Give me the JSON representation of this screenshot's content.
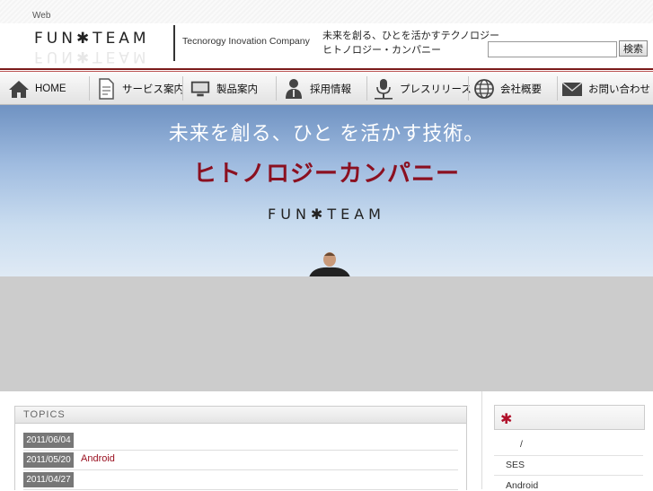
{
  "header": {
    "web_label": "Web",
    "logo_text": "FUN✱TEAM",
    "company": "Tecnorogy Inovation Company",
    "tagline_1": "未来を創る、ひとを活かすテクノロジー",
    "tagline_2": "ヒトノロジー・カンパニー",
    "search_value": "",
    "search_button": "検索"
  },
  "nav": {
    "items": [
      {
        "label": "HOME",
        "icon": "home-icon"
      },
      {
        "label": "サービス案内",
        "icon": "document-icon"
      },
      {
        "label": "製品案内",
        "icon": "monitor-icon"
      },
      {
        "label": "採用情報",
        "icon": "person-icon"
      },
      {
        "label": "プレスリリース",
        "icon": "microphone-icon"
      },
      {
        "label": "会社概要",
        "icon": "globe-icon"
      },
      {
        "label": "お問い合わせ",
        "icon": "mail-icon"
      }
    ]
  },
  "hero": {
    "line1": "未来を創る、ひと を活かす技術。",
    "line2": "ヒトノロジーカンパニー",
    "logo": "FUN✱TEAM"
  },
  "topics": {
    "heading": "TOPICS",
    "rows": [
      {
        "date": "2011/06/04",
        "title": ""
      },
      {
        "date": "2011/05/20",
        "title": "Android"
      },
      {
        "date": "2011/04/27",
        "title": ""
      }
    ]
  },
  "sidebar": {
    "links": [
      "/",
      "SES",
      "Android"
    ]
  },
  "colors": {
    "brand_red": "#8b1020",
    "accent_red": "#b0102a",
    "gray_block": "#cccccc"
  }
}
